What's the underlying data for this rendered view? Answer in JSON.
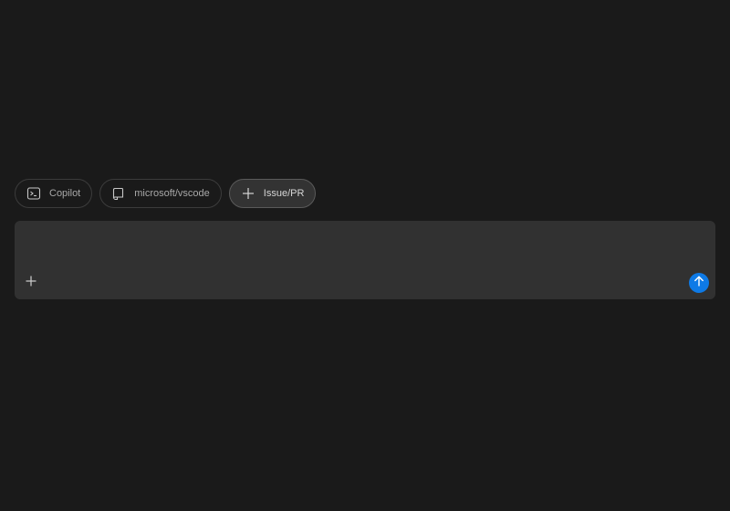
{
  "chips": [
    {
      "label": "Copilot",
      "icon": "terminal-icon"
    },
    {
      "label": "microsoft/vscode",
      "icon": "repo-icon"
    },
    {
      "label": "Issue/PR",
      "icon": "plus-icon",
      "active": true
    }
  ],
  "composer": {
    "value": "",
    "placeholder": "",
    "add_icon": "plus-icon",
    "send_icon": "arrow-up-icon"
  },
  "colors": {
    "background": "#1a1a1a",
    "composer": "#313131",
    "accent": "#0e7ae6"
  }
}
